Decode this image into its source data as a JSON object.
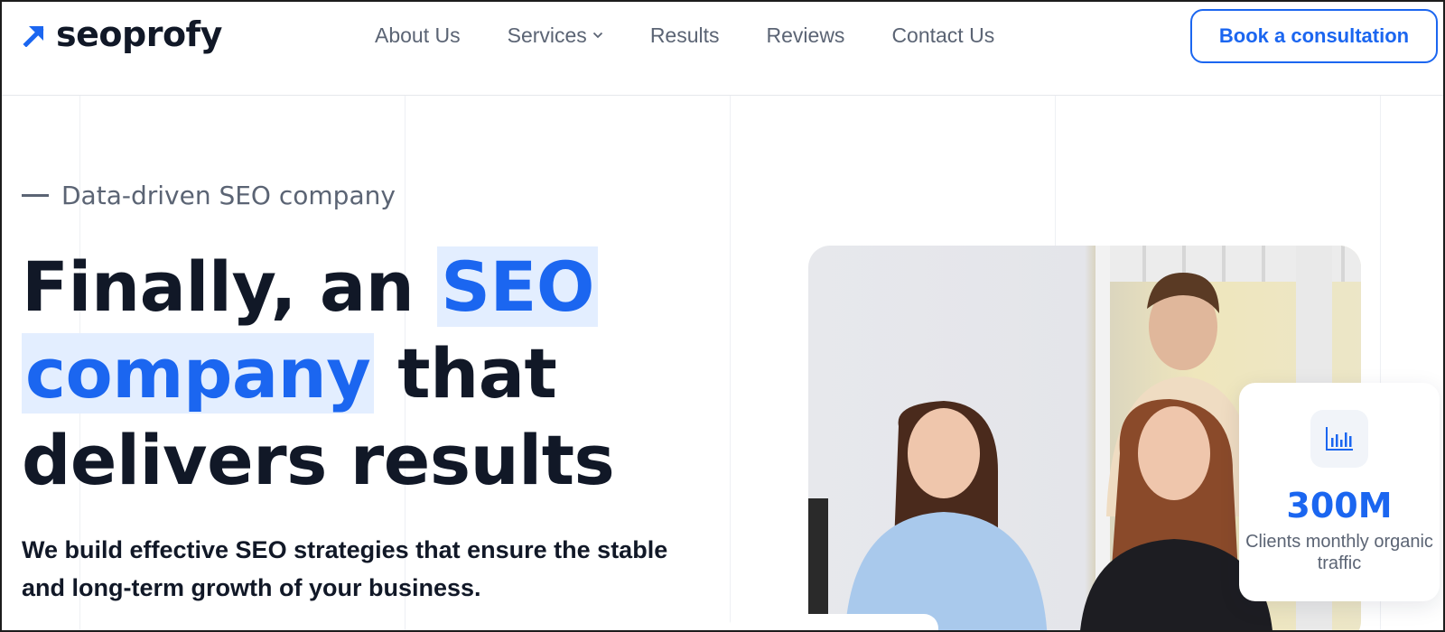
{
  "brand": {
    "name": "seoprofy",
    "accent": "#1b66f0",
    "logo_icon": "arrow-up-right-icon"
  },
  "nav": {
    "items": [
      {
        "label": "About Us"
      },
      {
        "label": "Services",
        "has_dropdown": true
      },
      {
        "label": "Results"
      },
      {
        "label": "Reviews"
      },
      {
        "label": "Contact Us"
      }
    ],
    "cta_label": "Book a consultation"
  },
  "hero": {
    "eyebrow": "Data-driven SEO company",
    "headline": {
      "part1": "Finally, an ",
      "highlight1": "SEO",
      "highlight2": "company",
      "part2": " that",
      "part3": "delivers results"
    },
    "subtext": "We build effective SEO strategies that ensure the stable and long-term growth of your business."
  },
  "stat": {
    "icon": "bar-chart-icon",
    "value": "300M",
    "label": "Clients monthly organic traffic"
  }
}
